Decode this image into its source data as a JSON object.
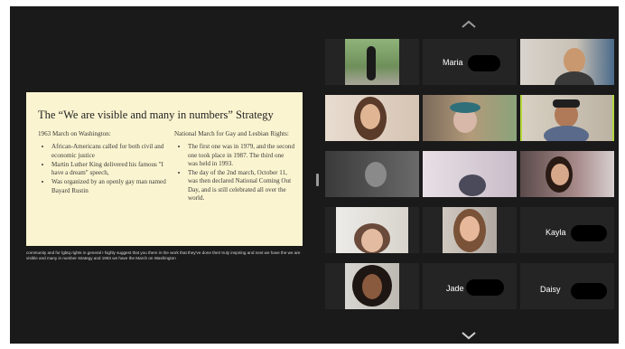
{
  "slide": {
    "title": "The “We are visible and many in numbers” Strategy",
    "left_heading": "1963 March on Washington:",
    "left_bullets": [
      "African-Americans called for both civil and economic justice",
      "Martin Luther King delivered his famous \"I have a dream\" speech,",
      "Was organized by an openly gay man named Bayard Rustin"
    ],
    "right_heading": "National March for Gay and Lesbian Rights:",
    "right_bullets": [
      "The first one was in 1979, and the second one took place in 1987. The third one was held in 1993.",
      "The day of the 2nd march, October 11, was then declared National Coming Out Day, and is still celebrated all over the world."
    ]
  },
  "caption": "community and for lgbtq rights in general I highly suggest that you them in the work that they've done their truly inspiring and next we have the we are visible and many in number strategy and 1963 we have the March on Washington",
  "participants": {
    "maria": "Maria",
    "kayla": "Kayla",
    "jade": "Jade",
    "daisy": "Daisy"
  },
  "colors": {
    "slide_bg": "#fbf4d0",
    "window_bg": "#1a1a1a",
    "active_speaker_border": "#b5d93d"
  },
  "icons": {
    "scroll_up": "chevron-up-icon",
    "scroll_down": "chevron-down-icon"
  }
}
